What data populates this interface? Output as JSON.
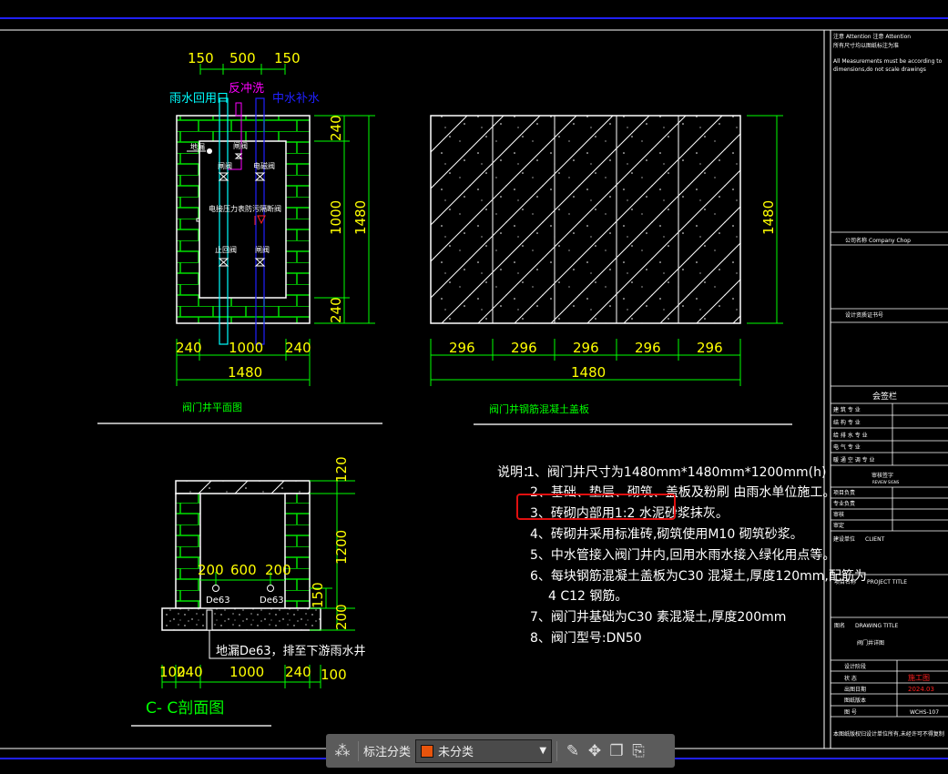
{
  "plan": {
    "top_dims": [
      "150",
      "500",
      "150"
    ],
    "labels": {
      "rain_return": "雨水回用口",
      "backwash": "反冲洗",
      "reclaimed": "中水补水",
      "floor_drain": "地漏",
      "gate1": "闸阀",
      "gate2": "闸阀",
      "solenoid": "电磁阀",
      "pressure_gauge": "电接压力表",
      "backflow": "防污隔断阀",
      "check": "止回阀",
      "gate3": "闸阀"
    },
    "right_dims": [
      "240",
      "1000",
      "1480",
      "240"
    ],
    "bottom_dims": [
      "240",
      "1000",
      "240",
      "1480"
    ],
    "title": "阀门井平面图"
  },
  "cover": {
    "panel_dims": [
      "296",
      "296",
      "296",
      "296",
      "296"
    ],
    "total": "1480",
    "height": "1480",
    "title": "阀门井钢筋混凝土盖板"
  },
  "section": {
    "pipe_dims": [
      "200",
      "600",
      "200"
    ],
    "pipes": [
      "De63",
      "De63"
    ],
    "right_dims": [
      "120",
      "1200",
      "150",
      "200"
    ],
    "drain_note": "地漏De63，排至下游雨水井",
    "bottom_dims": [
      "100",
      "240",
      "1000",
      "240",
      "100"
    ],
    "title": "C- C剖面图"
  },
  "notes": {
    "prefix": "说明：",
    "items": [
      "1、阀门井尺寸为1480mm*1480mm*1200mm(h)",
      "2、基础、垫层、砌筑、盖板及粉刷 由雨水单位施工。",
      "3、砖砌内部用1:2 水泥砂浆抹灰。",
      "4、砖砌井采用标准砖,砌筑使用M10 砌筑砂浆。",
      "5、中水管接入阀门井内,回用水雨水接入绿化用点等。",
      "6、每块钢筋混凝土盖板为C30 混凝土,厚度120mm,配筋为",
      "4 C12 钢筋。",
      "7、阀门井基础为C30 素混凝土,厚度200mm",
      "8、阀门型号:DN50"
    ],
    "highlight_color": "#e01010"
  },
  "title_block": {
    "attention": "注意  Attention  注意  Attention",
    "notice_cn": "所有尺寸均以图纸标注为准",
    "notice_en1": "All Measurements must be according to",
    "notice_en2": "dimensions,do not scale drawings",
    "company_label": "公司名称",
    "company": "Company Chop",
    "cert_label": "设计资质证书号",
    "sign_header": "会签栏",
    "sign_rows": [
      "建 筑 专 业",
      "结 构 专 业",
      "给 排 水 专 业",
      "电 气 专 业",
      "暖 通 空 调 专 业"
    ],
    "review_header": "审核签字",
    "review_sub": "REVIEW SIGNS",
    "review_rows": [
      "项目负责",
      "专业负责",
      "审核",
      "审定"
    ],
    "client_label": "建设单位",
    "client": "CLIENT",
    "project_label": "项目名称",
    "project": "PROJECT TITLE",
    "drawing_label": "图名",
    "drawing": "DRAWING TITLE",
    "drawing_name": "阀门井详图",
    "info_rows": [
      {
        "label": "设计阶段",
        "value": ""
      },
      {
        "label": "状 态",
        "value": "施工图"
      },
      {
        "label": "出图日期",
        "value": "2024.03"
      },
      {
        "label": "图纸版本",
        "value": ""
      },
      {
        "label": "图 号",
        "value": "WCHS-107"
      }
    ],
    "footer": "本图纸版权归设计单位所有,未经许可不得复制"
  },
  "toolbar": {
    "category_label": "标注分类",
    "category_value": "未分类",
    "category_color": "#e8540c"
  }
}
